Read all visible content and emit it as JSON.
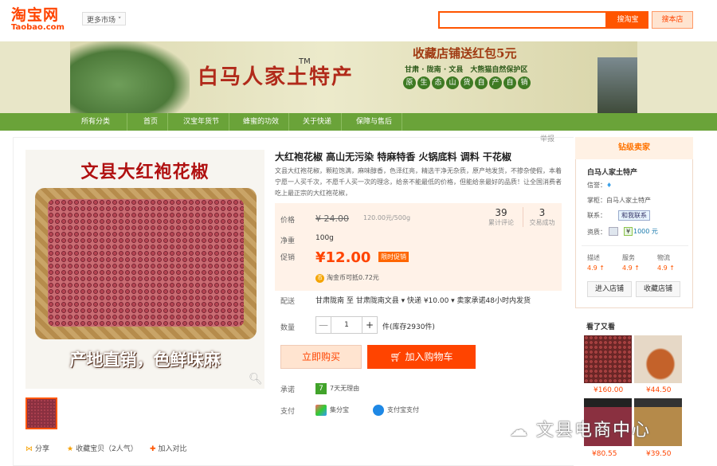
{
  "header": {
    "logo_cn": "淘宝网",
    "logo_en": "Taobao.com",
    "market_dropdown": "更多市场",
    "search_value": "",
    "search_button": "搜淘宝",
    "store_button": "搜本店"
  },
  "banner": {
    "brand": "白马人家土特产",
    "tm": "TM",
    "promo": "收藏店铺送红包5元",
    "location": "甘肃 · 陇南 · 文县　大熊猫自然保护区",
    "slogan": [
      "原",
      "生",
      "态",
      "山",
      "货",
      "自",
      "产",
      "自",
      "销"
    ]
  },
  "nav": [
    "所有分类 ▼",
    "首页",
    "汉宝年货节",
    "蜂蜜的功效",
    "关于快递",
    "保障与售后"
  ],
  "report": "举报",
  "product": {
    "image_title": "文县大红袍花椒",
    "image_slogan": "产地直销，色鲜味麻",
    "title": "大红袍花椒 高山无污染 特麻特香 火锅底料 调料 干花椒",
    "description": "文县大红袍花椒，颗粒饱满，麻味醇香，色泽红亮，精选干净无杂质，原产地发货，不掺杂使假，本着宁愿一人买千次，不愿千人买一次的理念，给亲不能最低的价格，但能给亲最好的品质！让全国消费者吃上最正宗的大红袍花椒，",
    "price_label": "价格",
    "old_price": "¥ 24.00",
    "unit_price": "120.00元/500g",
    "reviews_count": "39",
    "reviews_label": "累计评论",
    "sales_count": "3",
    "sales_label": "交易成功",
    "net_label": "净重",
    "net_value": "100g",
    "promo_label": "促销",
    "promo_price": "¥12.00",
    "promo_tag": "限时促销",
    "coin_icon": "币",
    "coin_text": "淘金币可抵0.72元",
    "ship_label": "配送",
    "ship_text": "甘肃陇南 至  甘肃陇南文县 ▾   快递 ¥10.00 ▾   卖家承诺48小时内发货",
    "qty_label": "数量",
    "qty_minus": "—",
    "qty_value": "1",
    "qty_plus": "+",
    "stock": "件(库存2930件)",
    "buy_now": "立即购买",
    "add_cart": "加入购物车",
    "promise_label": "承诺",
    "promise_icon": "7",
    "promise_text": "7天无理由",
    "pay_label": "支付",
    "pay1": "集分宝",
    "pay2": "支付宝支付",
    "share": "分享",
    "favorite": "收藏宝贝（2人气）",
    "compare": "加入对比"
  },
  "seller": {
    "heading": "钻级卖家",
    "name": "白马人家土特产",
    "credit_label": "信誉：",
    "keeper": "掌柜：白马人家土特产",
    "contact_label": "联系：",
    "contact_btn": "和我联系",
    "qual_label": "资质：",
    "q_badge": "¥",
    "q_value": "1000 元",
    "ratings": [
      {
        "label": "描述",
        "score": "4.9 ↑"
      },
      {
        "label": "服务",
        "score": "4.9 ↑"
      },
      {
        "label": "物流",
        "score": "4.9 ↑"
      }
    ],
    "enter_store": "进入店铺",
    "fav_store": "收藏店铺"
  },
  "also": {
    "title": "看了又看",
    "prices": [
      "¥160.00",
      "¥44.50",
      "¥80.55",
      "¥39.50"
    ]
  },
  "watermark": "文县电商中心"
}
